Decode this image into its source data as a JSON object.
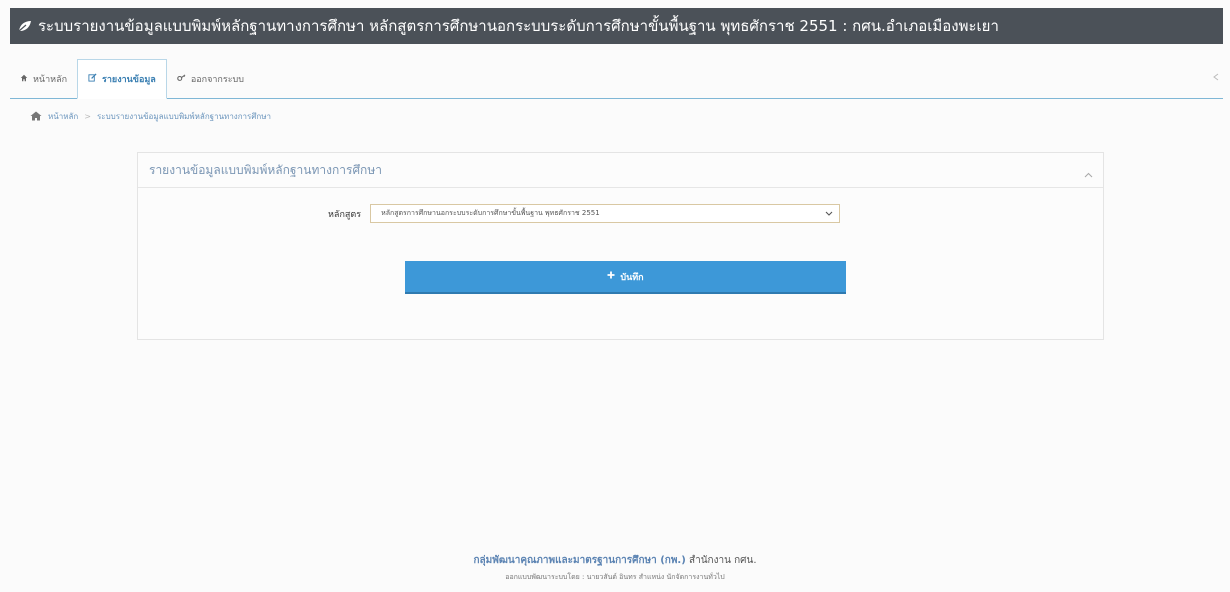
{
  "header": {
    "logo_icon": "leaf-icon",
    "title": "ระบบรายงานข้อมูลแบบพิมพ์หลักฐานทางการศึกษา หลักสูตรการศึกษานอกระบบระดับการศึกษาขั้นพื้นฐาน พุทธศักราช 2551 : กศน.อำเภอเมืองพะเยา"
  },
  "tabs": [
    {
      "label": "หน้าหลัก",
      "icon": "home-icon"
    },
    {
      "label": "รายงานข้อมูล",
      "icon": "edit-icon",
      "active": true
    },
    {
      "label": "ออกจากระบบ",
      "icon": "key-icon"
    }
  ],
  "breadcrumb": {
    "home": "หน้าหลัก",
    "separator": ">",
    "current": "ระบบรายงานข้อมูลแบบพิมพ์หลักฐานทางการศึกษา"
  },
  "panel": {
    "title": "รายงานข้อมูลแบบพิมพ์หลักฐานทางการศึกษา",
    "collapse_glyph": "^",
    "form": {
      "label": "หลักสูตร",
      "selected_value": "หลักสูตรการศึกษานอกระบบระดับการศึกษาขั้นพื้นฐาน พุทธศักราช 2551",
      "dropdown_glyph": "v"
    },
    "save_button": {
      "icon": "plus-icon",
      "label": "บันทึก"
    }
  },
  "footer": {
    "org": "กลุ่มพัฒนาคุณภาพและมาตรฐานการศึกษา (กพ.)",
    "office": "สำนักงาน กศน.",
    "credit": "ออกแบบพัฒนาระบบโดย : นายวสันต์ อินทร สำแหน่ง นักจัดการงานทั่วไป"
  },
  "colors": {
    "header_bg": "#4b5158",
    "accent": "#3d98d8",
    "tab_active_text": "#3a7fb2",
    "panel_title": "#7b96b4"
  }
}
